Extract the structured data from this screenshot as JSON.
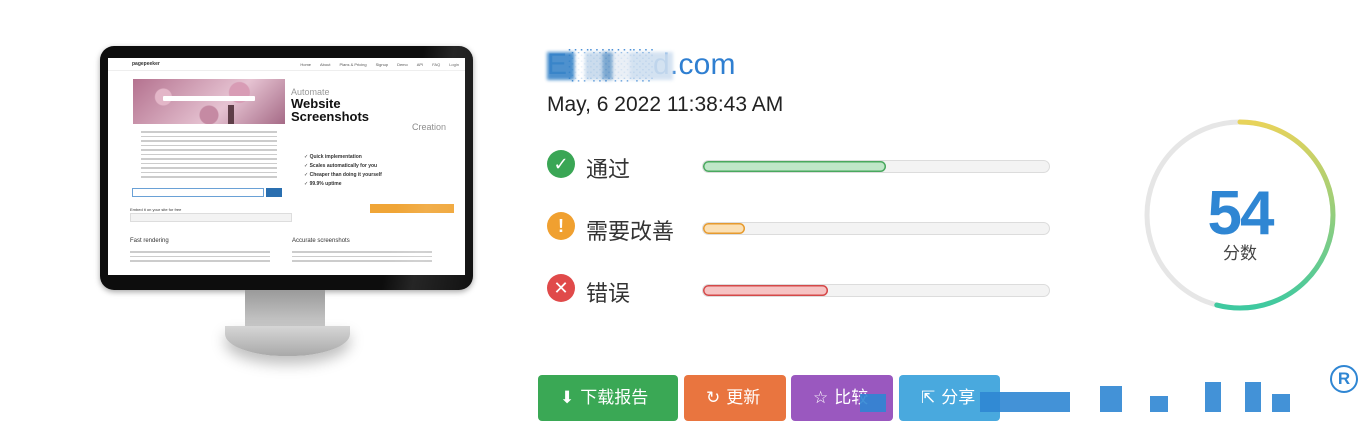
{
  "site": {
    "domain": "E░░░░d.com",
    "timestamp": "May, 6 2022 11:38:43 AM"
  },
  "thumbnail": {
    "logo": "pagepeeker",
    "nav": [
      "Home",
      "About",
      "Plans & Pricing",
      "Signup",
      "Demo",
      "API",
      "FAQ",
      "Login"
    ],
    "headline_small": "Automate",
    "headline_big": "Website Screenshots",
    "headline_tail": "Creation",
    "bullets": [
      "✓ Quick implementation",
      "✓ Scales automatically for you",
      "✓ Cheaper than doing it yourself",
      "✓ 99.9% uptime"
    ],
    "embed_title": "Embed it on your site for free",
    "feature_left": "Fast rendering",
    "feature_right": "Accurate screenshots"
  },
  "audit": {
    "rows": [
      {
        "label": "通过",
        "icon": "check-icon",
        "glyph": "✓",
        "color": "#3aa655",
        "fill_color": "#bfe6c8",
        "fill_border": "#49a85e",
        "fraction": 0.53
      },
      {
        "label": "需要改善",
        "icon": "exclamation-icon",
        "glyph": "!",
        "color": "#f0a030",
        "fill_color": "#fbe0b5",
        "fill_border": "#e69a2e",
        "fraction": 0.12
      },
      {
        "label": "错误",
        "icon": "x-icon",
        "glyph": "✕",
        "color": "#e04a4a",
        "fill_color": "#f6c3c3",
        "fill_border": "#d44848",
        "fraction": 0.36
      }
    ]
  },
  "score": {
    "value": "54",
    "label": "分数",
    "fraction": 0.54,
    "arc_colors": [
      "#3ec9a0",
      "#e8d35a"
    ],
    "track_color": "#e6e6e6"
  },
  "actions": [
    {
      "label": "下载报告",
      "icon": "download-icon",
      "glyph": "⬇",
      "color": "#3aa855"
    },
    {
      "label": "更新",
      "icon": "refresh-icon",
      "glyph": "↻",
      "color": "#e9753f"
    },
    {
      "label": "比较",
      "icon": "star-icon",
      "glyph": "☆",
      "color": "#9a58bf"
    },
    {
      "label": "分享",
      "icon": "share-icon",
      "glyph": "⇱",
      "color": "#49a9de"
    }
  ],
  "registered_mark": "R"
}
